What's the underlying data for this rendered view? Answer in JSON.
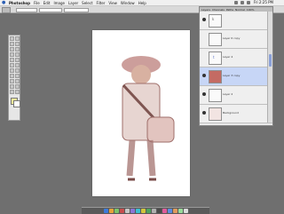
{
  "menubar": {
    "apple": "",
    "app_name": "Photoshop",
    "items": [
      "File",
      "Edit",
      "Image",
      "Layer",
      "Select",
      "Filter",
      "View",
      "Window",
      "Help"
    ],
    "clock": "Fri 2:25 PM"
  },
  "options_bar": {
    "labels": [
      "",
      ""
    ]
  },
  "layers": {
    "tabs": [
      "Layers",
      "Channels",
      "Paths"
    ],
    "blend_mode": "Normal",
    "opacity": "100%",
    "items": [
      {
        "name": "",
        "visible": true,
        "thumb": "k"
      },
      {
        "name": "Layer 6 copy",
        "visible": false,
        "thumb": ""
      },
      {
        "name": "Layer 4",
        "visible": false,
        "thumb": "t"
      },
      {
        "name": "Layer 3 copy",
        "visible": true,
        "thumb": "red",
        "selected": true
      },
      {
        "name": "Layer 2",
        "visible": true,
        "thumb": ""
      },
      {
        "name": "Background",
        "visible": true,
        "thumb": "img"
      }
    ]
  },
  "colors": {
    "accent": "#c46b63",
    "selection": "#c7d6f6",
    "dock_bg": "#5a5a5a"
  }
}
